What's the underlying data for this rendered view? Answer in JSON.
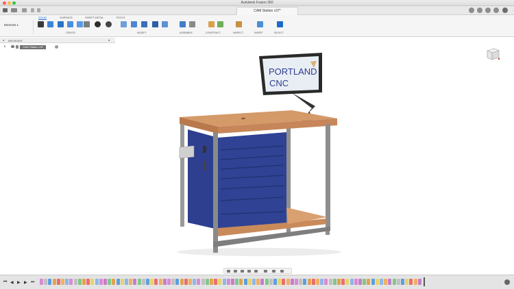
{
  "window": {
    "title": "Autodesk Fusion 360"
  },
  "document_tab": {
    "label": "CAM Station v37*"
  },
  "ribbon": {
    "workspace_label": "DESIGN",
    "tabs": [
      {
        "label": "SOLID",
        "active": true
      },
      {
        "label": "SURFACE",
        "active": false
      },
      {
        "label": "SHEET METAL",
        "active": false
      },
      {
        "label": "TOOLS",
        "active": false
      }
    ],
    "groups": [
      "CREATE",
      "MODIFY",
      "ASSEMBLE",
      "CONSTRUCT",
      "INSPECT",
      "INSERT",
      "SELECT"
    ]
  },
  "browser": {
    "header": "BROWSER",
    "root_component": "CAM Station v37"
  },
  "model": {
    "monitor_text_line1": "PORTLAND",
    "monitor_text_line2": "CNC"
  },
  "viewcube": {
    "label": "FRONT"
  },
  "colors": {
    "accent": "#1b6ac9",
    "wood": "#c98a5a",
    "cabinet_blue": "#2e3f8f",
    "frame_gray": "#8e8e8e"
  }
}
